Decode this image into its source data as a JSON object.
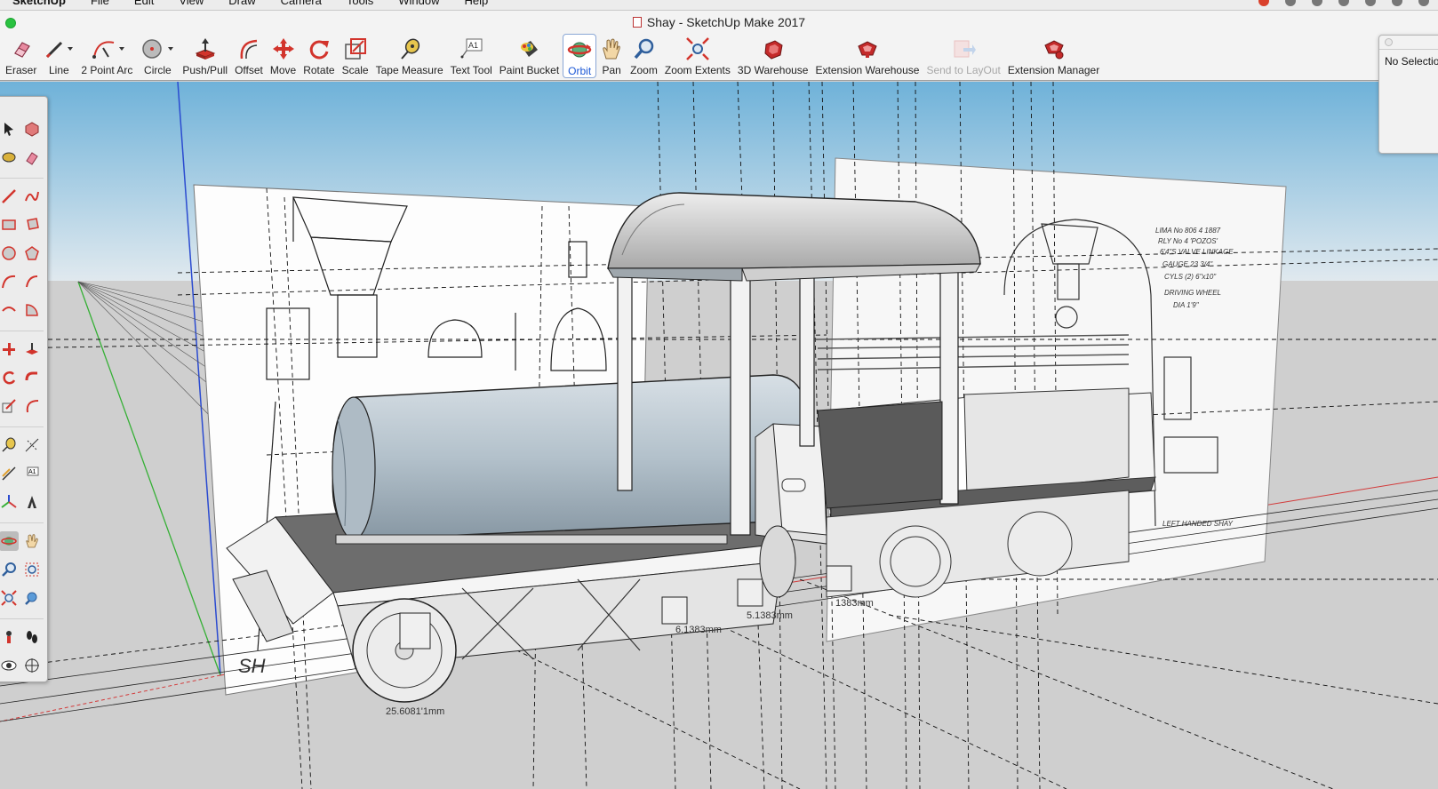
{
  "menubar": {
    "app": "SketchUp",
    "items": [
      "File",
      "Edit",
      "View",
      "Draw",
      "Camera",
      "Tools",
      "Window",
      "Help"
    ]
  },
  "window": {
    "title": "Shay - SketchUp Make 2017"
  },
  "toolbar": {
    "tools": [
      {
        "label": "Eraser",
        "icon": "eraser-icon"
      },
      {
        "label": "Line",
        "icon": "pencil-icon"
      },
      {
        "label": "2 Point Arc",
        "icon": "arc-icon"
      },
      {
        "label": "Circle",
        "icon": "circle-icon"
      },
      {
        "label": "Push/Pull",
        "icon": "push-pull-icon"
      },
      {
        "label": "Offset",
        "icon": "offset-icon"
      },
      {
        "label": "Move",
        "icon": "move-icon"
      },
      {
        "label": "Rotate",
        "icon": "rotate-icon"
      },
      {
        "label": "Scale",
        "icon": "scale-icon"
      },
      {
        "label": "Tape Measure",
        "icon": "tape-measure-icon"
      },
      {
        "label": "Text Tool",
        "icon": "text-icon"
      },
      {
        "label": "Paint Bucket",
        "icon": "paint-bucket-icon"
      },
      {
        "label": "Orbit",
        "icon": "orbit-icon",
        "active": true
      },
      {
        "label": "Pan",
        "icon": "hand-icon"
      },
      {
        "label": "Zoom",
        "icon": "magnifier-icon"
      },
      {
        "label": "Zoom Extents",
        "icon": "zoom-extents-icon"
      },
      {
        "label": "3D Warehouse",
        "icon": "warehouse-icon"
      },
      {
        "label": "Extension Warehouse",
        "icon": "extension-warehouse-icon"
      },
      {
        "label": "Send to LayOut",
        "icon": "send-layout-icon",
        "disabled": true
      },
      {
        "label": "Extension Manager",
        "icon": "extension-manager-icon"
      }
    ]
  },
  "entity_info": {
    "text": "No Selectio"
  },
  "viewport": {
    "dimension_labels": [
      "25.6081'1mm",
      "6.1383mm",
      "5.1383mm",
      "1383mm"
    ],
    "drawing_notes": [
      "LIMA No 806 4 1887",
      "RLY No 4 'POZOS'",
      "6'4\"S VALVE LINKAGE",
      "GAUGE 23 3/4\"",
      "CYLS (2) 6\"x10\"",
      "DRIVING WHEEL",
      "DIA 1'9\"",
      "LEFT HANDED SHAY"
    ]
  },
  "colors": {
    "sky_top": "#6fb2d9",
    "sky_bottom": "#dde7ee",
    "ground": "#cfcfcf",
    "accent_active": "#1a57d6",
    "tool_red": "#d2342c"
  }
}
